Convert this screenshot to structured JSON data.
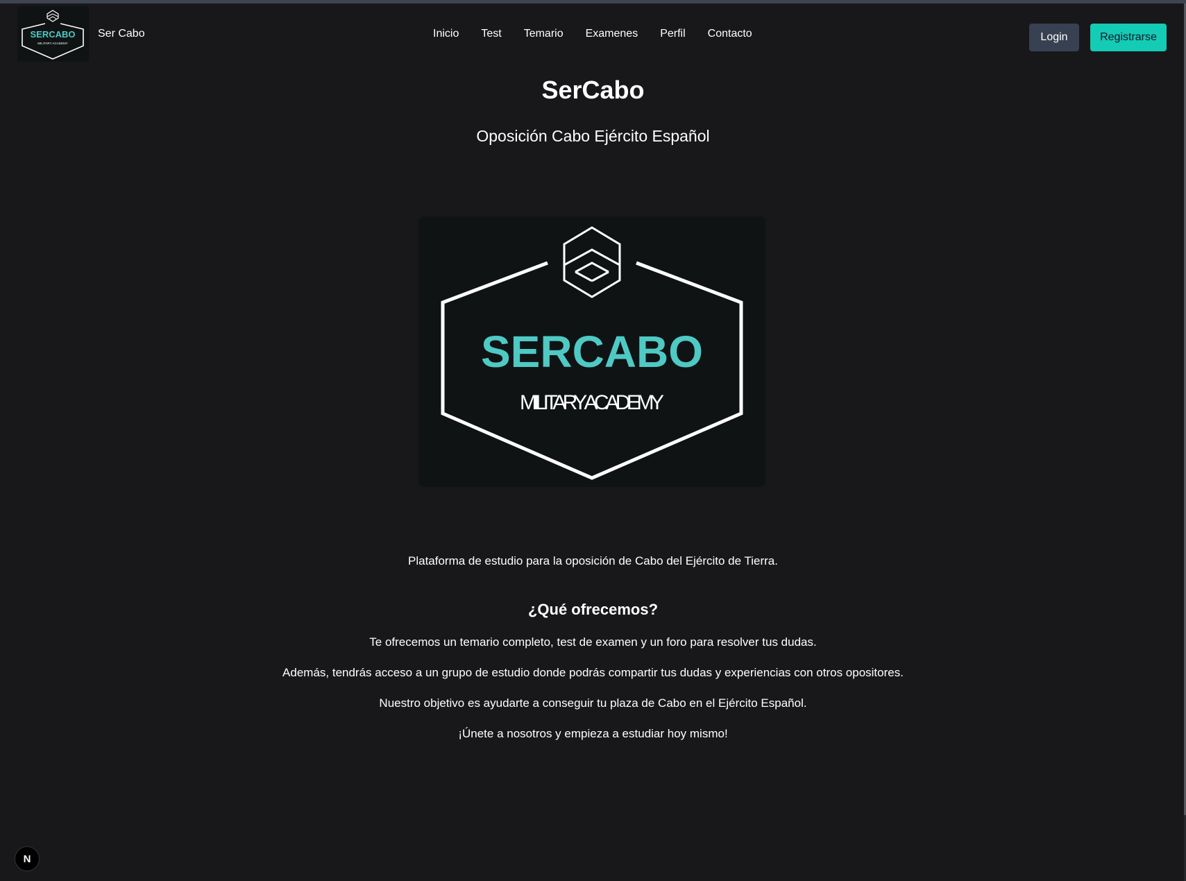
{
  "colors": {
    "background": "#18181b",
    "accent": "#14cbb5",
    "login_bg": "#374151",
    "logo_teal": "#4fc9c4"
  },
  "brand": {
    "name": "Ser Cabo",
    "logo_text": "SERCABO",
    "logo_subtext": "MILITARY ACADEMY"
  },
  "nav": {
    "items": [
      "Inicio",
      "Test",
      "Temario",
      "Examenes",
      "Perfil",
      "Contacto"
    ]
  },
  "auth": {
    "login_label": "Login",
    "register_label": "Registrarse"
  },
  "hero": {
    "title": "SerCabo",
    "subtitle": "Oposición Cabo Ejército Español",
    "logo_text": "SERCABO",
    "logo_subtext": "MILITARY ACADEMY"
  },
  "content": {
    "intro": "Plataforma de estudio para la oposición de Cabo del Ejército de Tierra.",
    "offer_title": "¿Qué ofrecemos?",
    "paragraphs": [
      "Te ofrecemos un temario completo, test de examen y un foro para resolver tus dudas.",
      "Además, tendrás acceso a un grupo de estudio donde podrás compartir tus dudas y experiencias con otros opositores.",
      "Nuestro objetivo es ayudarte a conseguir tu plaza de Cabo en el Ejército Español.",
      "¡Únete a nosotros y empieza a estudiar hoy mismo!"
    ]
  },
  "dev_badge": {
    "icon": "nextjs-icon",
    "letter": "N"
  }
}
